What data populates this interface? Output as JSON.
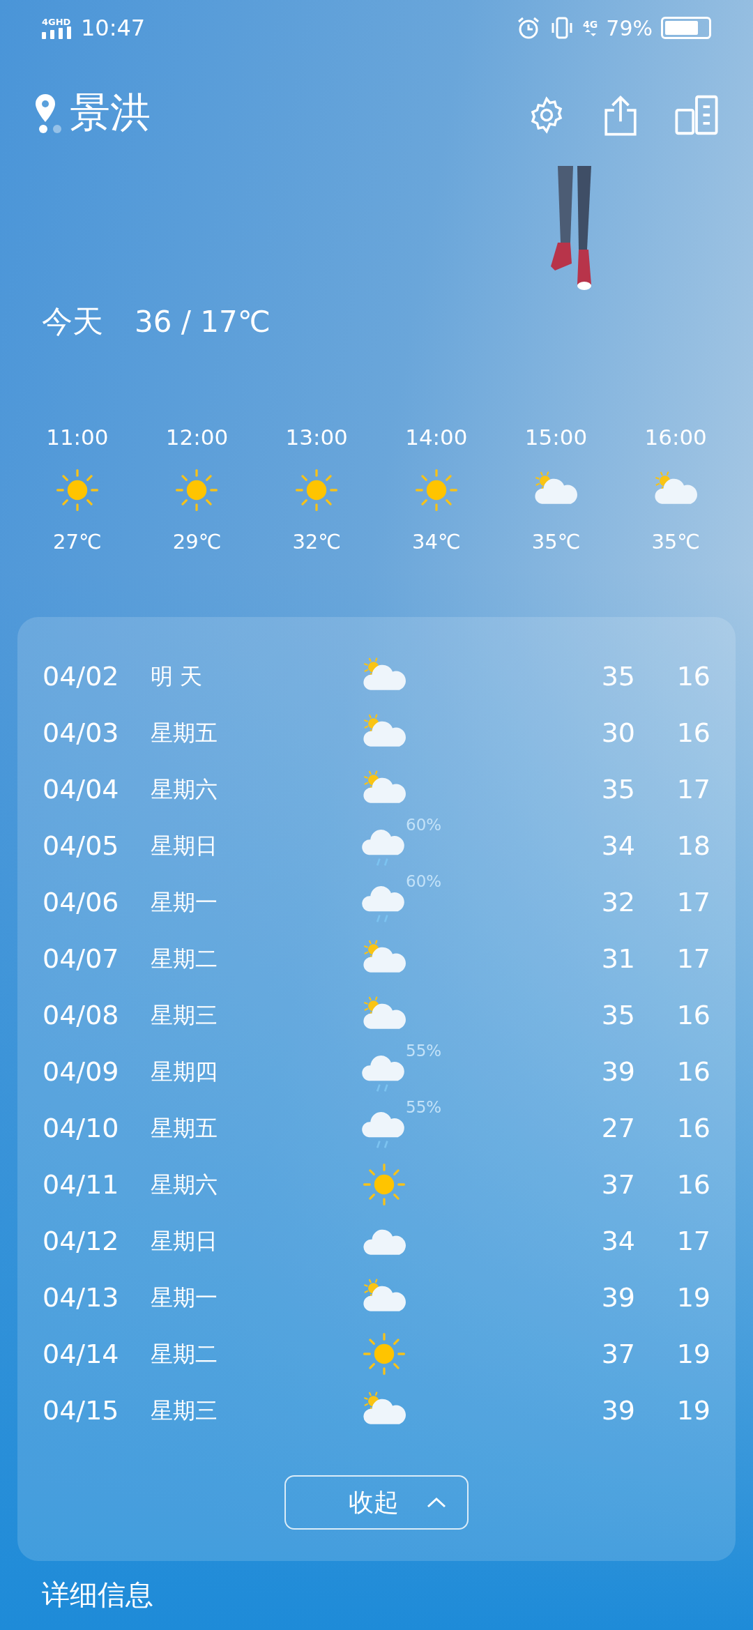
{
  "status_bar": {
    "network": "4GHD",
    "time": "10:47",
    "data": "4G",
    "battery": "79%"
  },
  "header": {
    "city": "景洪",
    "pages": [
      {
        "selected": true
      },
      {
        "selected": false
      }
    ]
  },
  "today": {
    "label": "今天",
    "range": "36 / 17℃"
  },
  "hourly": [
    {
      "time": "11:00",
      "kind": "sun",
      "temp": "27℃"
    },
    {
      "time": "12:00",
      "kind": "sun",
      "temp": "29℃"
    },
    {
      "time": "13:00",
      "kind": "sun",
      "temp": "32℃"
    },
    {
      "time": "14:00",
      "kind": "sun",
      "temp": "34℃"
    },
    {
      "time": "15:00",
      "kind": "partly",
      "temp": "35℃"
    },
    {
      "time": "16:00",
      "kind": "partly",
      "temp": "35℃"
    }
  ],
  "daily": [
    {
      "date": "04/02",
      "day": "明 天",
      "kind": "partly",
      "high": "35",
      "low": "16"
    },
    {
      "date": "04/03",
      "day": "星期五",
      "kind": "partly",
      "high": "30",
      "low": "16"
    },
    {
      "date": "04/04",
      "day": "星期六",
      "kind": "partly",
      "high": "35",
      "low": "17"
    },
    {
      "date": "04/05",
      "day": "星期日",
      "kind": "rain",
      "chance": "60%",
      "high": "34",
      "low": "18"
    },
    {
      "date": "04/06",
      "day": "星期一",
      "kind": "rain",
      "chance": "60%",
      "high": "32",
      "low": "17"
    },
    {
      "date": "04/07",
      "day": "星期二",
      "kind": "partly",
      "high": "31",
      "low": "17"
    },
    {
      "date": "04/08",
      "day": "星期三",
      "kind": "partly",
      "high": "35",
      "low": "16"
    },
    {
      "date": "04/09",
      "day": "星期四",
      "kind": "rain",
      "chance": "55%",
      "high": "39",
      "low": "16"
    },
    {
      "date": "04/10",
      "day": "星期五",
      "kind": "rain",
      "chance": "55%",
      "high": "27",
      "low": "16"
    },
    {
      "date": "04/11",
      "day": "星期六",
      "kind": "sun",
      "high": "37",
      "low": "16"
    },
    {
      "date": "04/12",
      "day": "星期日",
      "kind": "cloud",
      "high": "34",
      "low": "17"
    },
    {
      "date": "04/13",
      "day": "星期一",
      "kind": "partly",
      "high": "39",
      "low": "19"
    },
    {
      "date": "04/14",
      "day": "星期二",
      "kind": "sun",
      "high": "37",
      "low": "19"
    },
    {
      "date": "04/15",
      "day": "星期三",
      "kind": "partly",
      "high": "39",
      "low": "19"
    }
  ],
  "collapse_button": "收起",
  "details_title": "详细信息"
}
